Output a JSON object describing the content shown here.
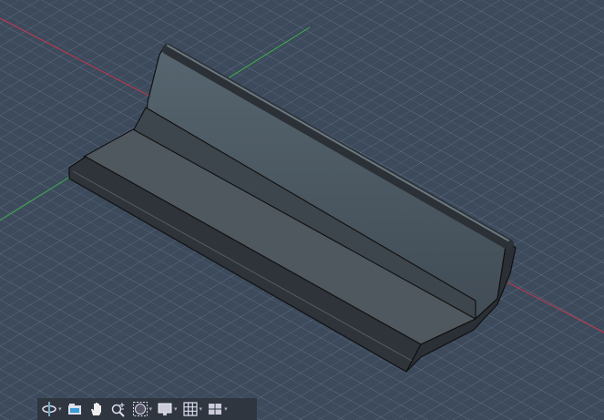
{
  "viewport": {
    "background": "#3c4a5c",
    "axis_colors": {
      "x": "#c0394a",
      "y": "#3fae49"
    },
    "model_color": "#4a525a"
  },
  "toolbar": {
    "items": [
      {
        "icon": "orbit-icon",
        "has_dropdown": true
      },
      {
        "icon": "look-at-icon",
        "has_dropdown": false
      },
      {
        "icon": "pan-hand-icon",
        "has_dropdown": false
      },
      {
        "icon": "zoom-icon",
        "has_dropdown": false
      },
      {
        "icon": "fit-window-icon",
        "has_dropdown": true
      },
      {
        "icon": "display-settings-icon",
        "has_dropdown": true
      },
      {
        "icon": "grid-icon",
        "has_dropdown": true
      },
      {
        "icon": "viewports-icon",
        "has_dropdown": true
      }
    ],
    "dropdown_glyph": "▾"
  }
}
